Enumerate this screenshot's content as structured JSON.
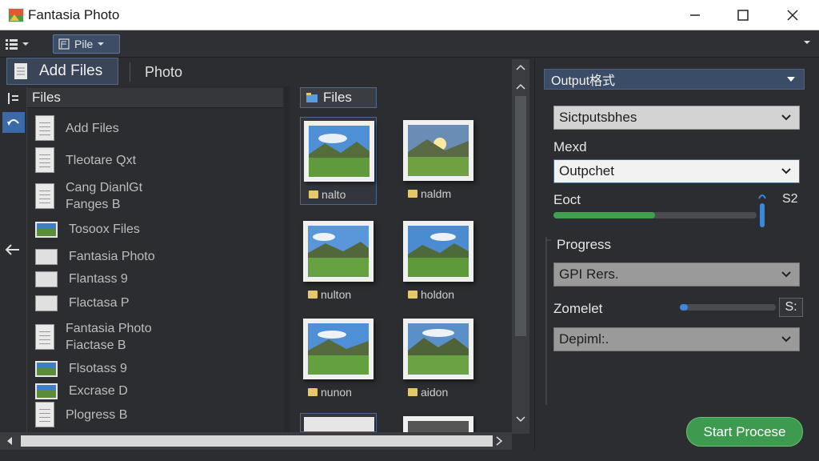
{
  "window": {
    "title": "Fantasia Photo"
  },
  "menu": {
    "file_label": "Pile"
  },
  "tabs": {
    "add_files": "Add Files",
    "photo": "Photo"
  },
  "files_header": "Files",
  "file_list": [
    {
      "text": "Add Files",
      "icon": "document-icon"
    },
    {
      "text": "Tleotare Qxt",
      "icon": "document-icon"
    },
    {
      "text": "Cang DianlGt\nFanges B",
      "icon": "document-icon"
    },
    {
      "text": "Tosoox Files",
      "icon": "image-icon"
    },
    {
      "text": "Fantasia Photo",
      "icon": "folder-icon"
    },
    {
      "text": "Flantass 9",
      "icon": "folder-icon"
    },
    {
      "text": "Flactasa P",
      "icon": "folder-icon"
    },
    {
      "text": "Fantasia Photo\nFiactase B",
      "icon": "document-icon"
    },
    {
      "text": "Flsotass 9",
      "icon": "image-icon"
    },
    {
      "text": "Excrase D",
      "icon": "image-icon"
    },
    {
      "text": "Plogress B",
      "icon": "document-icon"
    }
  ],
  "gallery": {
    "tab_label": "Files",
    "thumbnails": [
      {
        "label": "nalto",
        "selected": true
      },
      {
        "label": "naldm",
        "selected": false
      },
      {
        "label": "nulton",
        "selected": false
      },
      {
        "label": "holdon",
        "selected": false
      },
      {
        "label": "nunon",
        "selected": false
      },
      {
        "label": "aidon",
        "selected": false
      }
    ]
  },
  "right_panel": {
    "output_dropdown": "Output格式",
    "setting_dropdown": "Sictputsbhes",
    "mexd_label": "Mexd",
    "outpchet_dropdown": "Outpchet",
    "ext_label": "Eoct",
    "ext_value": "S2",
    "ext_progress": 0.5,
    "progress_label": "Progress",
    "gpu_dropdown": "GPI Rers.",
    "zomelet_label": "Zomelet",
    "zomelet_value": "S:",
    "zomelet_progress": 0.03,
    "depiml_dropdown": "Depiml:.",
    "start_button": "Start Procese"
  },
  "colors": {
    "accent_blue": "#3b4c66",
    "progress_green": "#3fa14d",
    "slider_blue": "#3a88d8",
    "start_green": "#3d9b4f"
  }
}
